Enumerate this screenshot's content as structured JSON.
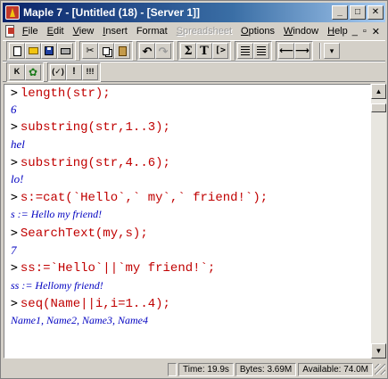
{
  "window": {
    "title": "Maple 7 - [Untitled (18) - [Server 1]]",
    "buttons": {
      "minimize": "_",
      "maximize": "□",
      "close": "✕"
    }
  },
  "menu": {
    "items": [
      {
        "label": "File",
        "u": "F",
        "rest": "ile"
      },
      {
        "label": "Edit",
        "u": "E",
        "rest": "dit"
      },
      {
        "label": "View",
        "u": "V",
        "rest": "iew"
      },
      {
        "label": "Insert",
        "u": "I",
        "rest": "nsert"
      },
      {
        "label": "Format",
        "u": "",
        "rest": "Format"
      },
      {
        "label": "Spreadsheet",
        "u": "S",
        "rest": "preadsheet"
      },
      {
        "label": "Options",
        "u": "O",
        "rest": "ptions"
      },
      {
        "label": "Window",
        "u": "W",
        "rest": "indow"
      },
      {
        "label": "Help",
        "u": "H",
        "rest": "elp"
      }
    ],
    "mdi_buttons": [
      "_",
      "▫",
      "✕"
    ]
  },
  "toolbar1": {
    "text_button": "T",
    "sigma_button": "Σ",
    "bracket_button": "[>"
  },
  "toolbar2": {
    "buttons": [
      "K",
      "(✓)",
      "!",
      "!!!"
    ]
  },
  "worksheet": {
    "lines": [
      {
        "type": "input",
        "prompt": ">",
        "text": "length(str);"
      },
      {
        "type": "output",
        "text": "6"
      },
      {
        "type": "input",
        "prompt": ">",
        "text": "substring(str,1..3);"
      },
      {
        "type": "output",
        "text": "hel"
      },
      {
        "type": "input",
        "prompt": ">",
        "text": "substring(str,4..6);"
      },
      {
        "type": "output",
        "text": "lo!"
      },
      {
        "type": "input",
        "prompt": ">",
        "text": "s:=cat(`Hello`,` my`,` friend!`);"
      },
      {
        "type": "output",
        "text": "s := Hello my friend!"
      },
      {
        "type": "input",
        "prompt": ">",
        "text": "SearchText(my,s);"
      },
      {
        "type": "output",
        "text": "7"
      },
      {
        "type": "input",
        "prompt": ">",
        "text": "ss:=`Hello`||`my friend!`;"
      },
      {
        "type": "output",
        "text": "ss := Hellomy friend!"
      },
      {
        "type": "input",
        "prompt": ">",
        "text": "seq(Name||i,i=1..4);"
      },
      {
        "type": "output",
        "text": "Name1, Name2, Name3, Name4"
      }
    ]
  },
  "status": {
    "time": "Time: 19.9s",
    "bytes": "Bytes: 3.69M",
    "available": "Available: 74.0M"
  }
}
